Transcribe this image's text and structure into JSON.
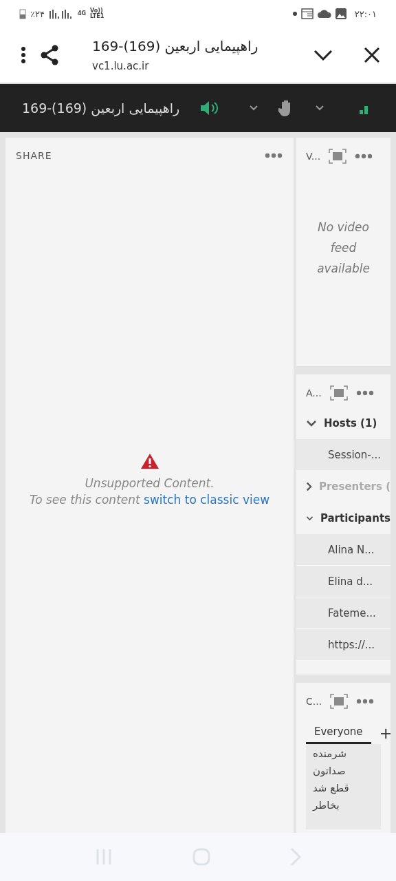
{
  "status_bar": {
    "battery": "٪۲۴",
    "network": "4G",
    "volte": "Vo))",
    "lte": "LTE1",
    "time": "۲۲:۰۱"
  },
  "browser": {
    "title": "راهپیمایی اربعین (169)-169",
    "url": "vc1.lu.ac.ir"
  },
  "toolbar": {
    "meeting_title": "راهپیمایی اربعین (169)-169"
  },
  "share_pod": {
    "title": "SHARE",
    "message": "Unsupported Content.",
    "hint": "To see this content",
    "link": "switch to classic view"
  },
  "video_pod": {
    "title": "V...",
    "message": "No video feed available"
  },
  "attendees_pod": {
    "title": "A...",
    "groups": [
      {
        "label": "Hosts (1)",
        "expanded": true,
        "children": [
          {
            "name": "Session-..."
          }
        ]
      },
      {
        "label": "Presenters (",
        "expanded": false
      },
      {
        "label": "Participants",
        "expanded": true,
        "children": [
          {
            "name": "Alina N..."
          },
          {
            "name": "Elina d..."
          },
          {
            "name": "Fateme..."
          },
          {
            "name": "https://..."
          }
        ]
      }
    ]
  },
  "chat_pod": {
    "title": "C...",
    "tabs": [
      {
        "label": "Everyone",
        "selected": true
      }
    ],
    "messages": [
      "شرمنده",
      "صداتون",
      "قطع شد",
      "بخاطر"
    ]
  }
}
